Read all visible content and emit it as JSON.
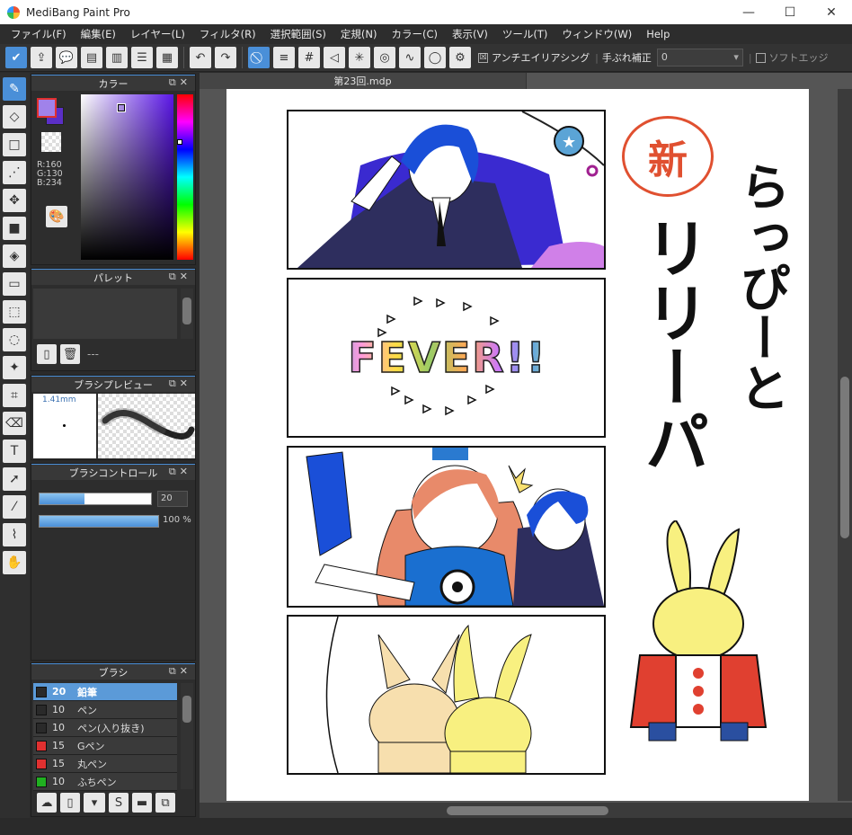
{
  "window": {
    "title": "MediBang Paint Pro",
    "minimize": "—",
    "maximize": "☐",
    "close": "✕"
  },
  "menu": [
    "ファイル(F)",
    "編集(E)",
    "レイヤー(L)",
    "フィルタ(R)",
    "選択範囲(S)",
    "定規(N)",
    "カラー(C)",
    "表示(V)",
    "ツール(T)",
    "ウィンドウ(W)",
    "Help"
  ],
  "toolbar": {
    "antialias_label": "アンチエイリアシング",
    "antialias_checked": "☒",
    "stabilizer_label": "手ぶれ補正",
    "stabilizer_value": "0",
    "soft_edge_label": "ソフトエッジ"
  },
  "color_panel": {
    "title": "カラー",
    "r": "R:160",
    "g": "G:130",
    "b": "B:234",
    "foreground": "#a082ea",
    "background": "#5b2fc7"
  },
  "palette_panel": {
    "title": "パレット",
    "status": "---"
  },
  "brush_preview_panel": {
    "title": "ブラシプレビュー",
    "size": "1.41mm"
  },
  "brush_control_panel": {
    "title": "ブラシコントロール",
    "size_value": "20",
    "opacity_value": "100 %",
    "size_fraction": 0.4,
    "opacity_fraction": 1.0
  },
  "brush_panel": {
    "title": "ブラシ",
    "items": [
      {
        "size": "20",
        "name": "鉛筆",
        "color": "#2a2a2a",
        "selected": true
      },
      {
        "size": "10",
        "name": "ペン",
        "color": "#2a2a2a",
        "selected": false
      },
      {
        "size": "10",
        "name": "ペン(入り抜き)",
        "color": "#2a2a2a",
        "selected": false
      },
      {
        "size": "15",
        "name": "Gペン",
        "color": "#e03030",
        "selected": false
      },
      {
        "size": "15",
        "name": "丸ペン",
        "color": "#e03030",
        "selected": false
      },
      {
        "size": "10",
        "name": "ふちペン",
        "color": "#20b020",
        "selected": false
      }
    ]
  },
  "document": {
    "tab": "第23回.mdp",
    "manga_text": {
      "fever": "FEVER!!",
      "stamp": "新",
      "title_col1": "らっぴーと",
      "title_col2": "リリーパ"
    }
  }
}
